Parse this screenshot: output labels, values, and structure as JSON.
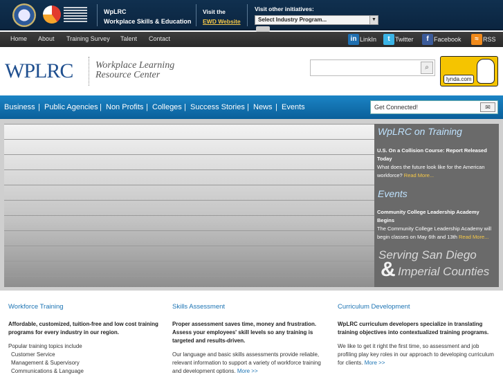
{
  "topbar": {
    "title_line1": "WpLRC",
    "title_line2": "Workplace Skills & Education",
    "visit_line1": "Visit the",
    "visit_link": "EWD Website",
    "other_label": "Visit other initiatives:",
    "select_value": "Select Industry Program..."
  },
  "nav": {
    "items": [
      "Home",
      "About",
      "Training Survey",
      "Talent",
      "Contact"
    ],
    "social": [
      "LinkIn",
      "Twitter",
      "Facebook",
      "RSS"
    ]
  },
  "header": {
    "brand": "WPLRC",
    "sub_line1": "Workplace Learning",
    "sub_line2": "Resource Center",
    "lynda": "lynda.com"
  },
  "bluebar": {
    "items": [
      "Business",
      "Public Agencies",
      "Non Profits",
      "Colleges",
      "Success Stories",
      "News",
      "Events"
    ],
    "connect": "Get Connected!"
  },
  "side": {
    "training_head": "WpLRC on Training",
    "training_title": "U.S. On a Collision Course: Report Released Today",
    "training_body": "What does the future look like for the American workforce?",
    "events_head": "Events",
    "events_title": "Community College Leadership Academy Begins",
    "events_body": "The Community College Leadership Academy will begin classes on May 6th and 13th",
    "read_more": "Read More...",
    "serving_l1": "Serving San Diego",
    "serving_amp": "&",
    "serving_l2": "Imperial Counties"
  },
  "columns": [
    {
      "heading": "Workforce Training",
      "lead": "Affordable, customized, tuition-free and low cost training programs for every industry in our region.",
      "topics_label": "Popular training topics include",
      "topics": [
        "Customer Service",
        "Management & Supervisory",
        "Communications & Language"
      ]
    },
    {
      "heading": "Skills Assessment",
      "lead": "Proper assessment saves time, money and frustration. Assess your employees' skill levels so any training is targeted and results-driven.",
      "body": "Our language and basic skills assessments provide reliable, relevant information to support a variety of workforce training and development options.",
      "more": "More >>"
    },
    {
      "heading": "Curriculum Development",
      "lead": "WpLRC curriculum developers  specialize in translating training objectives into contextualized training programs.",
      "body": "We like to get it right the first time, so assessment and job profiling play key roles in our approach to developing curriculum for clients.",
      "more": "More >>"
    }
  ],
  "colors": {
    "accent": "#1b73b3",
    "nav_blue": "#0a5f9a",
    "topbar": "#10304f",
    "highlight": "#f7c948"
  }
}
